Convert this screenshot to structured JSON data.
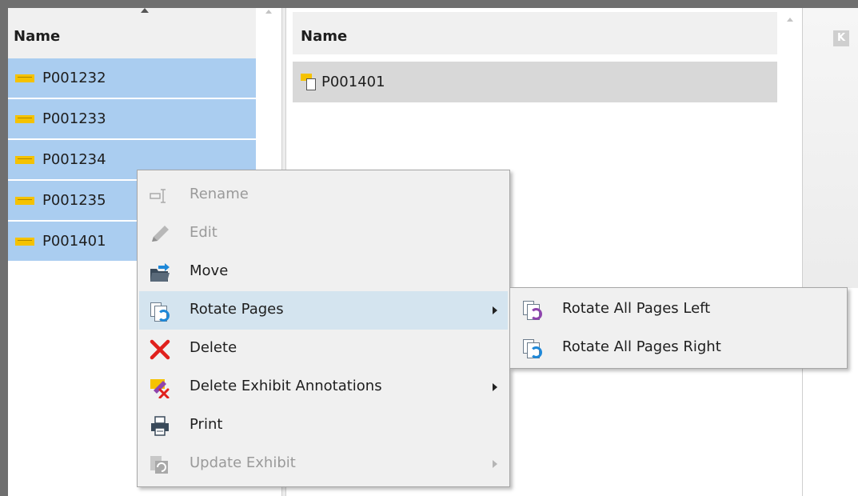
{
  "left_pane": {
    "header": "Name",
    "rows": [
      "P001232",
      "P001233",
      "P001234",
      "P001235",
      "P001401"
    ]
  },
  "right_pane": {
    "header": "Name",
    "rows": [
      "P001401"
    ]
  },
  "context_menu": {
    "items": [
      {
        "label": "Rename",
        "enabled": false,
        "icon": "rename-icon"
      },
      {
        "label": "Edit",
        "enabled": false,
        "icon": "pencil-icon"
      },
      {
        "label": "Move",
        "enabled": true,
        "icon": "move-folder-icon"
      },
      {
        "label": "Rotate Pages",
        "enabled": true,
        "icon": "rotate-pages-icon",
        "submenu": true,
        "highlighted": true
      },
      {
        "label": "Delete",
        "enabled": true,
        "icon": "red-x-icon"
      },
      {
        "label": "Delete Exhibit Annotations",
        "enabled": true,
        "icon": "delete-annotations-icon",
        "submenu": true
      },
      {
        "label": "Print",
        "enabled": true,
        "icon": "printer-icon"
      },
      {
        "label": "Update Exhibit",
        "enabled": false,
        "icon": "update-exhibit-icon",
        "submenu": true
      }
    ]
  },
  "rotate_submenu": {
    "items": [
      {
        "label": "Rotate All Pages Left",
        "icon": "rotate-left-icon"
      },
      {
        "label": "Rotate All Pages Right",
        "icon": "rotate-right-icon"
      }
    ]
  },
  "colors": {
    "selection": "#aacdf0",
    "menu_highlight": "#d4e4ef",
    "menu_background": "#f0f0f0",
    "delete_red": "#e0201c",
    "rotate_blue": "#1e88d8",
    "rotate_purple": "#8e44ad"
  }
}
